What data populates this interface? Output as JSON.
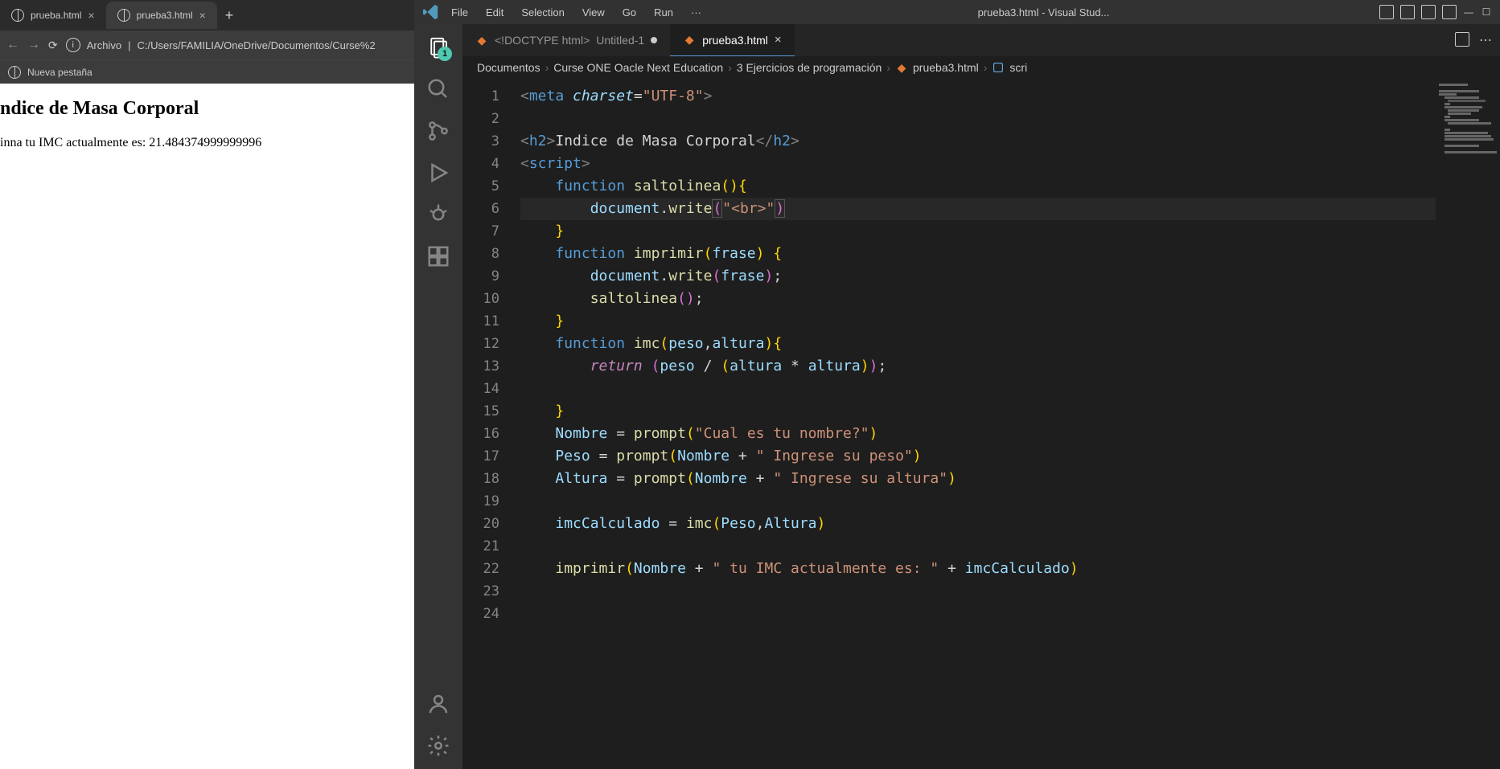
{
  "browser": {
    "tabs": [
      {
        "title": "prueba.html"
      },
      {
        "title": "prueba3.html"
      }
    ],
    "url_prefix": "Archivo",
    "url": "C:/Users/FAMILIA/OneDrive/Documentos/Curse%2",
    "bookmark": "Nueva pestaña",
    "page_h2": "ndice de Masa Corporal",
    "page_text": "inna tu IMC actualmente es: 21.484374999999996"
  },
  "vscode": {
    "menu": [
      "File",
      "Edit",
      "Selection",
      "View",
      "Go",
      "Run",
      "···"
    ],
    "window_title": "prueba3.html - Visual Stud...",
    "explorer_badge": "1",
    "tabs": [
      {
        "context": "<!DOCTYPE html>",
        "label": "Untitled-1",
        "dirty": true,
        "active": false
      },
      {
        "label": "prueba3.html",
        "dirty": false,
        "active": true
      }
    ],
    "breadcrumb": [
      "Documentos",
      "Curse ONE  Oacle Next Education",
      "3 Ejercicios de programación",
      "prueba3.html",
      "scri"
    ],
    "line_numbers": [
      "1",
      "2",
      "3",
      "4",
      "5",
      "6",
      "7",
      "8",
      "9",
      "10",
      "11",
      "12",
      "13",
      "14",
      "15",
      "16",
      "17",
      "18",
      "19",
      "20",
      "21",
      "22",
      "23",
      "24"
    ],
    "code": {
      "l1_charset": "\"UTF-8\"",
      "l3_text": "Indice de Masa Corporal",
      "l5_fn": "saltolinea",
      "l6_arg": "\"<br>\"",
      "l8_fn": "imprimir",
      "l8_param": "frase",
      "l9_arg": "frase",
      "l10_call": "saltolinea",
      "l12_fn": "imc",
      "l12_p1": "peso",
      "l12_p2": "altura",
      "l13_p1": "peso",
      "l13_p2": "altura",
      "l13_p3": "altura",
      "l16_var": "Nombre",
      "l16_str": "\"Cual es tu nombre?\"",
      "l17_var": "Peso",
      "l17_n": "Nombre",
      "l17_str": "\" Ingrese su peso\"",
      "l18_var": "Altura",
      "l18_n": "Nombre",
      "l18_str": "\" Ingrese su altura\"",
      "l20_var": "imcCalculado",
      "l20_fn": "imc",
      "l20_a1": "Peso",
      "l20_a2": "Altura",
      "l22_fn": "imprimir",
      "l22_n": "Nombre",
      "l22_str": "\" tu IMC actualmente es: \"",
      "l22_v": "imcCalculado"
    }
  }
}
